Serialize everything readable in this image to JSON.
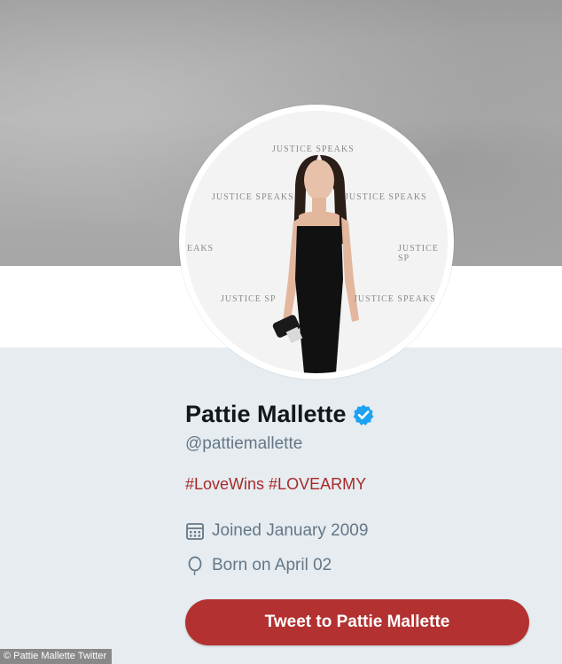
{
  "profile": {
    "name": "Pattie Mallette",
    "handle": "@pattiemallette",
    "bio": "#LoveWins #LOVEARMY",
    "joined": "Joined January 2009",
    "born": "Born on April 02",
    "verified_icon": "verified-badge-icon",
    "joined_icon": "calendar-icon",
    "born_icon": "balloon-icon"
  },
  "actions": {
    "tweet_to_label": "Tweet to Pattie Mallette"
  },
  "avatar": {
    "backdrop_text_1": "JUSTICE SPEAKS",
    "backdrop_text_2": "JUSTICE SPEAKS",
    "backdrop_text_3": "EAKS",
    "backdrop_text_4": "JUSTICE SP",
    "backdrop_text_5": "JUSTICE SP",
    "backdrop_text_6": "JUSTICE SPEAKS",
    "backdrop_text_7": "JUSTICE SPEAKS"
  },
  "caption": {
    "credit": "© Pattie Mallette Twitter"
  },
  "colors": {
    "background": "#e6ecf0",
    "name": "#14171a",
    "secondary_text": "#657786",
    "bio_link": "#a82a2a",
    "button": "#b33131",
    "verified": "#1da1f2"
  }
}
